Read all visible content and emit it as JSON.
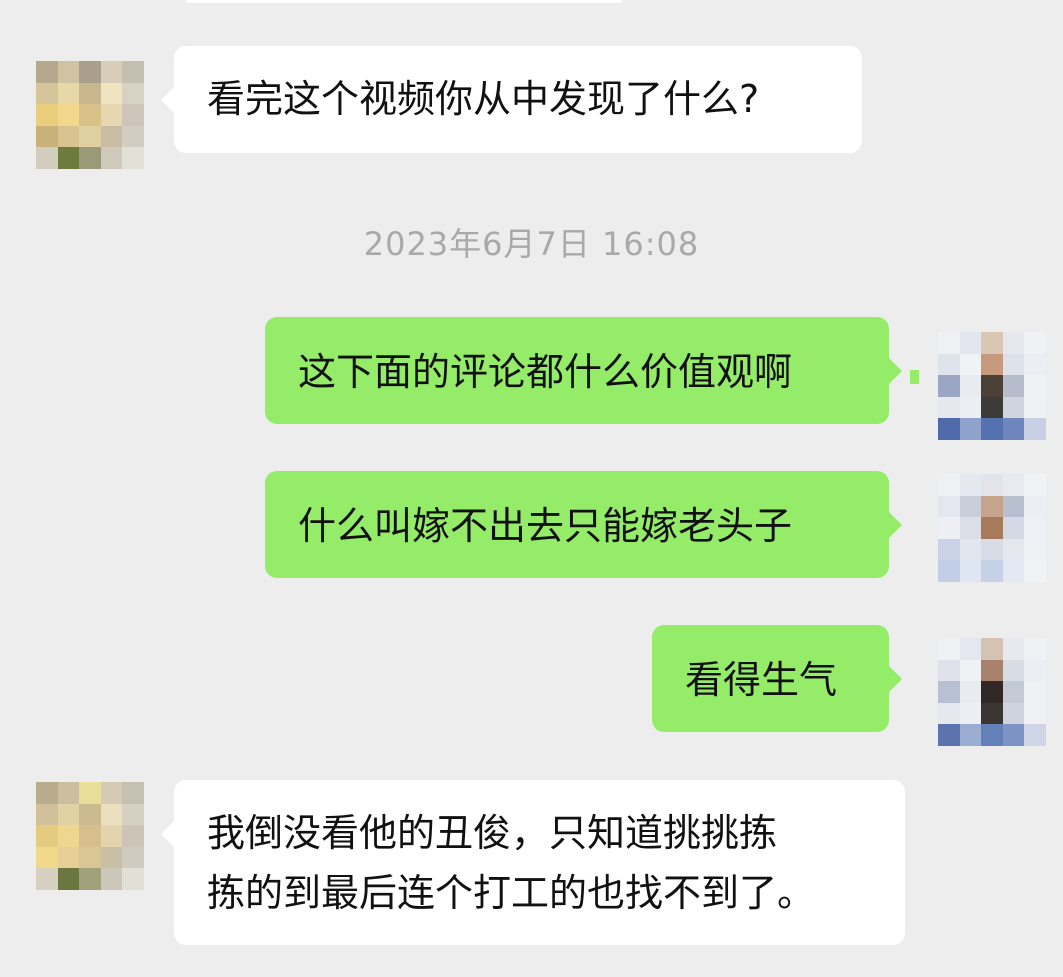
{
  "chat": {
    "timestamp": "2023年6月7日 16:08",
    "messages": [
      {
        "side": "incoming",
        "lines": [
          "看完这个视频你从中发现了什么?"
        ]
      },
      {
        "side": "outgoing",
        "lines": [
          "这下面的评论都什么价值观啊"
        ]
      },
      {
        "side": "outgoing",
        "lines": [
          "什么叫嫁不出去只能嫁老头子"
        ]
      },
      {
        "side": "outgoing",
        "lines": [
          "看得生气"
        ]
      },
      {
        "side": "incoming",
        "lines": [
          "我倒没看他的丑俊，只知道挑挑拣",
          "拣的到最后连个打工的也找不到了。"
        ]
      }
    ]
  },
  "colors": {
    "background": "#ededed",
    "incoming_bubble": "#ffffff",
    "outgoing_bubble": "#95ec69",
    "timestamp_text": "#a9a9a9"
  }
}
